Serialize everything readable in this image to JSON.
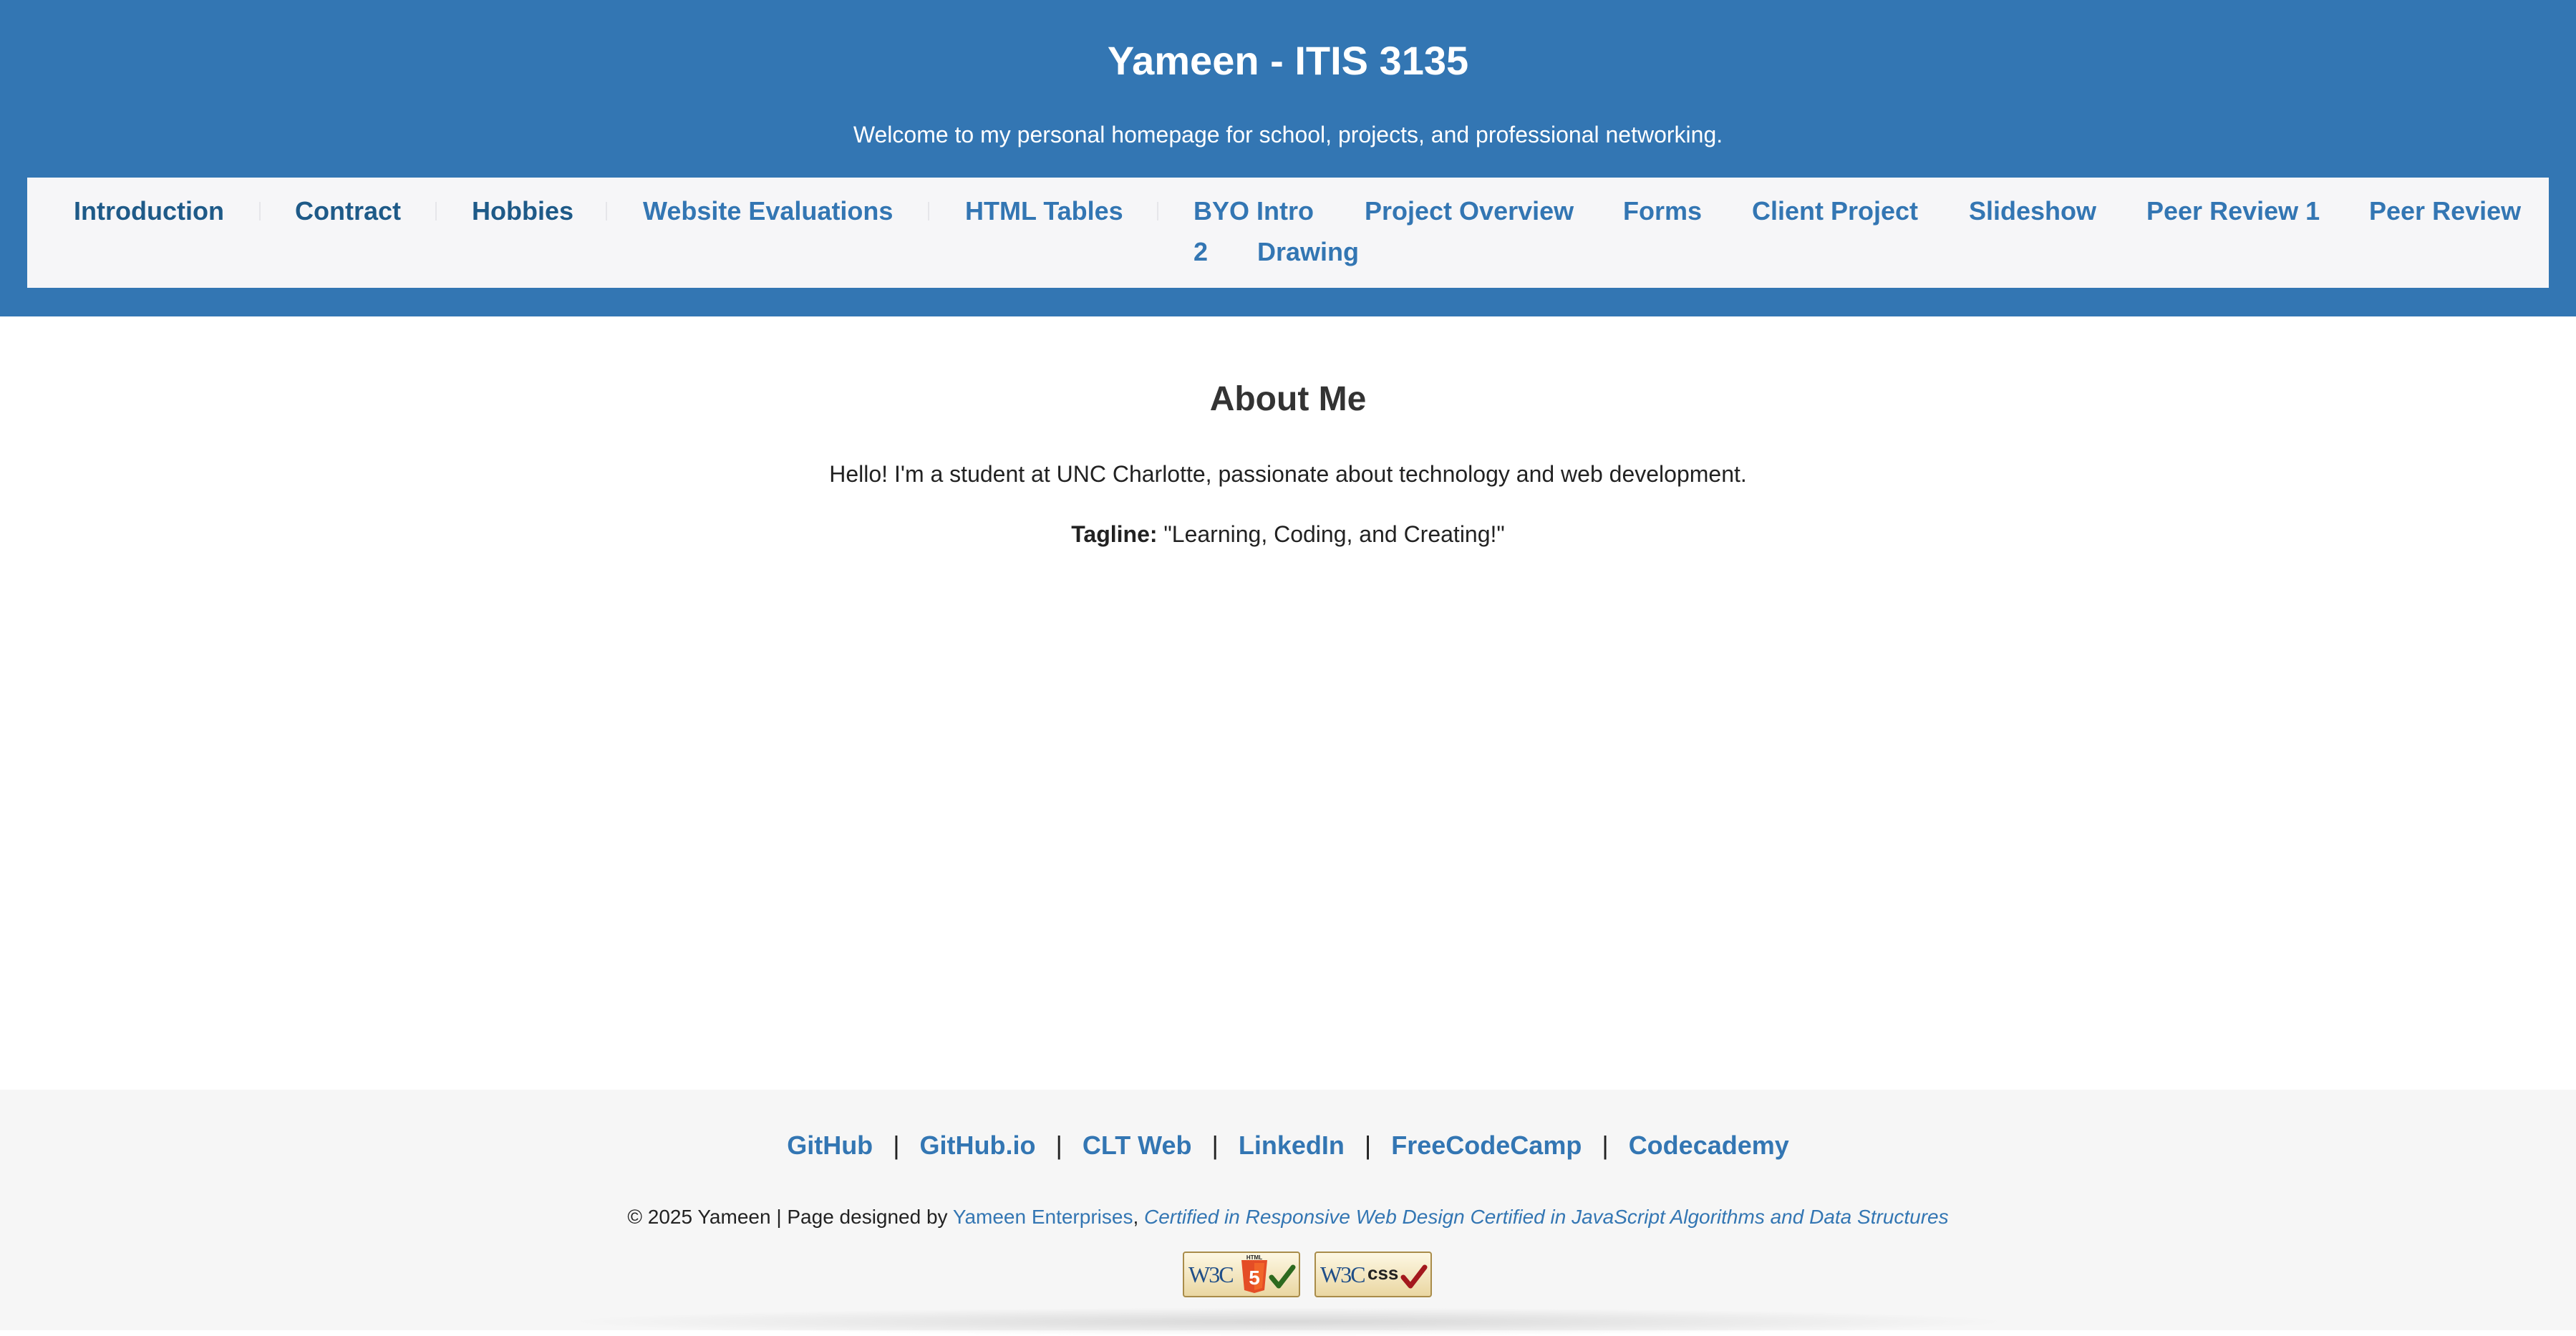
{
  "header": {
    "title": "Yameen - ITIS 3135",
    "subtitle": "Welcome to my personal homepage for school, projects, and professional networking."
  },
  "nav": {
    "items": [
      {
        "label": "Introduction"
      },
      {
        "label": "Contract"
      },
      {
        "label": "Hobbies"
      },
      {
        "label": "Website Evaluations"
      },
      {
        "label": "HTML Tables"
      },
      {
        "label": "BYO Intro"
      },
      {
        "label": "Project Overview"
      },
      {
        "label": "Forms"
      },
      {
        "label": "Client Project"
      },
      {
        "label": "Slideshow"
      },
      {
        "label": "Peer Review 1"
      },
      {
        "label": "Peer Review"
      },
      {
        "label": "2"
      },
      {
        "label": "Drawing"
      }
    ]
  },
  "main": {
    "heading": "About Me",
    "intro": "Hello! I'm a student at UNC Charlotte, passionate about technology and web development.",
    "tagline_label": "Tagline:",
    "tagline_text": "\"Learning, Coding, and Creating!\""
  },
  "footer": {
    "links": [
      {
        "label": "GitHub"
      },
      {
        "label": "GitHub.io"
      },
      {
        "label": "CLT Web"
      },
      {
        "label": "LinkedIn"
      },
      {
        "label": "FreeCodeCamp"
      },
      {
        "label": "Codecademy"
      }
    ],
    "separator": "|",
    "copyright": "© 2025 Yameen | Page designed by",
    "designer": "Yameen Enterprises",
    "comma": ",",
    "certifications": "Certified in Responsive Web Design Certified in JavaScript Algorithms and Data Structures",
    "badges": [
      {
        "logo": "W3C",
        "mark": "HTML 5",
        "icon": "html5-validator-badge"
      },
      {
        "logo": "W3C",
        "mark": "css",
        "icon": "css-validator-badge"
      }
    ]
  },
  "colors": {
    "header_bg": "#3376b3",
    "nav_bg": "#f6f6f8",
    "link": "#3376b3",
    "link_visited": "#1e5a88",
    "footer_bg": "#f6f6f6"
  }
}
